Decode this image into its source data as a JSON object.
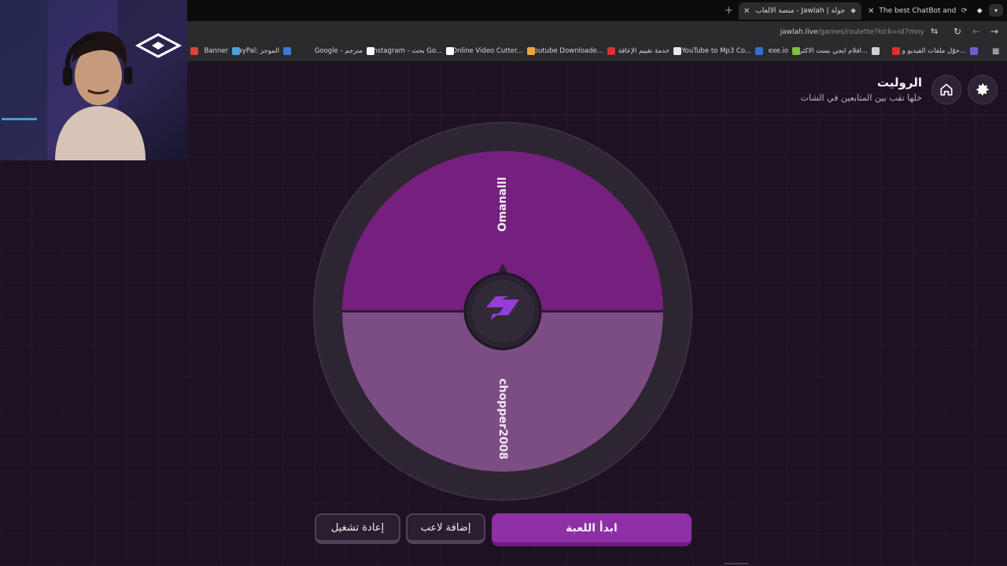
{
  "browser": {
    "tabs": [
      {
        "title": "The best ChatBot and Widg",
        "active": false
      },
      {
        "title": "جولة | Jawlah - منصة الألعاب التـ",
        "active": true
      }
    ],
    "new_tab_symbol": "+",
    "url_host": "jawlah.live",
    "url_path": "/games/roulette?kick=id7mny",
    "bookmarks": [
      {
        "label": "حوّل ملفات الفيديو و...",
        "color": "#6b5fd6",
        "icon": "video-converter-icon"
      },
      {
        "label": "",
        "color": "#e0302b",
        "icon": "youtube-icon"
      },
      {
        "label": "افلام ايجي بست الاكثر...",
        "color": "#cfcfcf",
        "icon": "egybest-icon"
      },
      {
        "label": "exe.io",
        "color": "#7fbf3f",
        "icon": "exeio-icon"
      },
      {
        "label": "YouTube to Mp3 Co...",
        "color": "#2f6fd6",
        "icon": "yt-mp3-icon"
      },
      {
        "label": "خدمة تقييم الإعاقة",
        "color": "#e8e8e8",
        "icon": "disability-icon"
      },
      {
        "label": "Youtube Downloade...",
        "color": "#e0302b",
        "icon": "yt-downloader-icon"
      },
      {
        "label": "Online Video Cutter...",
        "color": "#f2a53a",
        "icon": "video-cutter-icon"
      },
      {
        "label": "instagram - بحث Go...",
        "color": "#ffffff",
        "icon": "google-icon"
      },
      {
        "label": "Google - مترجم",
        "color": "#ffffff",
        "icon": "google-icon"
      },
      {
        "label": "PayPal: الموجز",
        "color": "#3a7bd5",
        "icon": "paypal-icon"
      },
      {
        "label": "Banner",
        "color": "#4aa3d8",
        "icon": "banner-icon"
      },
      {
        "label": "",
        "color": "#d44638",
        "icon": "gmail-icon"
      }
    ]
  },
  "page": {
    "title": "الروليت",
    "subtitle": "خلها تقب بين المتابعين في الشات"
  },
  "wheel": {
    "segments": [
      {
        "name": "Omanalll",
        "color": "#75207f"
      },
      {
        "name": "chopper2008",
        "color": "#7c4c85"
      }
    ],
    "rim_color": "#2e2532",
    "hub_logo_color": "#9a3ee0"
  },
  "buttons": {
    "start": "ابدأ اللعبة",
    "add_player": "إضافة لاعب",
    "reset": "إعادة تشغيل"
  }
}
